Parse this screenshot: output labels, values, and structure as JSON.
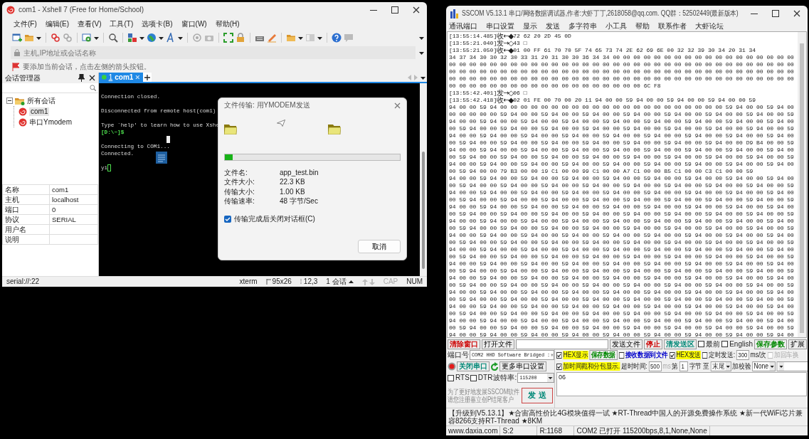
{
  "xshell": {
    "title": "com1 - Xshell 7 (Free for Home/School)",
    "menu": [
      "文件(F)",
      "编辑(E)",
      "查看(V)",
      "工具(T)",
      "选项卡(B)",
      "窗口(W)",
      "帮助(H)"
    ],
    "address": {
      "placeholder": "主机,IP地址或会话名称"
    },
    "hint": "要添加当前会话，点击左侧的箭头按钮。",
    "session_manager": {
      "title": "会话管理器",
      "tree": [
        {
          "label": "所有会话",
          "expanded": true,
          "children": [
            {
              "label": "com1",
              "selected": true
            },
            {
              "label": "串口Ymodem",
              "selected": false
            }
          ]
        }
      ],
      "properties": [
        {
          "name": "名称",
          "value": "com1"
        },
        {
          "name": "主机",
          "value": "localhost"
        },
        {
          "name": "端口",
          "value": "0"
        },
        {
          "name": "协议",
          "value": "SERIAL"
        },
        {
          "name": "用户名"
        },
        {
          "name": "说明"
        }
      ]
    },
    "tabs": [
      {
        "number": "1",
        "label": "com1",
        "selected": true,
        "connected": true
      }
    ],
    "terminal": {
      "lines": [
        {
          "kind": "blank"
        },
        {
          "kind": "text",
          "text": "Connection closed."
        },
        {
          "kind": "blank"
        },
        {
          "kind": "text",
          "text": "Disconnected from remote host(com1)"
        },
        {
          "kind": "blank"
        },
        {
          "kind": "text",
          "text": "Type `help' to learn how to use Xshe"
        },
        {
          "kind": "prompt",
          "text": "[D:\\~]$"
        },
        {
          "kind": "cursor"
        },
        {
          "kind": "text",
          "text": "Connecting to COM1..."
        },
        {
          "kind": "text",
          "text": "Connected."
        },
        {
          "kind": "blank"
        },
        {
          "kind": "input",
          "text": "yi"
        }
      ]
    },
    "dialog": {
      "title": "文件传输: 用YMODEM发送",
      "level": 0.045,
      "fields": [
        {
          "label": "文件名:",
          "value": "app_test.bin"
        },
        {
          "label": "文件大小:",
          "value": "22.3 KB"
        },
        {
          "label": "传输大小:",
          "value": "1.00 KB"
        },
        {
          "label": "传输速率:",
          "value": "48 字节/Sec"
        }
      ],
      "close_when_done": {
        "label": "传输完成后关闭对话框(C)",
        "checked": true
      },
      "cancel": "取消"
    },
    "status_bar": {
      "path": "serial://:22",
      "terminal_type": "xterm",
      "size": "95x26",
      "cursor": "12,3",
      "sessions": "1 会话",
      "keys": [
        {
          "label": "CAP",
          "on": false
        },
        {
          "label": "NUM",
          "on": true
        }
      ]
    }
  },
  "sscom": {
    "title": "SSCOM V5.13.1 串口/网络数据调试器,作者:大虾丁丁,2618058@qq.com. QQ群：52502449(最新版本)",
    "menu": [
      "通讯端口",
      "串口设置",
      "显示",
      "发送",
      "多字符串",
      "小工具",
      "帮助",
      "联系作者",
      "大虾论坛"
    ],
    "log": [
      {
        "time": "[13:55:14.485]",
        "dir": "收←◆",
        "bytes": "72 62 20 2D 45 0D"
      },
      {
        "time": "[13:55:21.040]",
        "dir": "发→◇",
        "bytes": "43 □"
      },
      {
        "time": "[13:55:21.050]",
        "dir": "收←◆",
        "bytes": "01 00 FF 61 70 70 5F 74 65 73 74 2E 62 69 6E 00 32 32 39 30 34 20 31 34"
      },
      {
        "bytes": "34 37 34 30 30 32 30 33 31 20 31 30 30 36 34 34 00 00 00 00 00 00 00 00 00 00 00 00 00 00 00 00 00 00"
      },
      {
        "bytes": "00 00 00 00 00 00 00 00 00 00 00 00 00 00 00 00 00 00 00 00 00 00 00 00 00 00 00 00 00 00 00 00 00 00"
      },
      {
        "bytes": "00 00 00 00 00 00 00 00 00 00 00 00 00 00 00 00 00 00 00 00 00 00 00 00 00 00 00 00 00 00 00 00 00 00"
      },
      {
        "bytes": "00 00 00 00 00 00 00 00 00 00 00 00 00 00 00 00 00 00 00 00 00 00 00 00 00 00 00 00 00 00 00 00 00 00"
      },
      {
        "bytes": "00 00 00 00 00 00 00 00 00 00 00 00 00 00 00 00 00 00 00 6C F8"
      },
      {
        "time": "[13:55:42.401]",
        "dir": "发→◇",
        "bytes": "06 □"
      },
      {
        "time": "[13:55:42.418]",
        "dir": "收←◆",
        "bytes": "02 01 FE 00 70 00 20 11 94 00 00 59 94 00 00 59 94 00 00 59 94 00 00 59"
      },
      {
        "bytes": "94 00 00 59 94 00 00 00 00 00 00 00 00 00 00 00 00 00 00 00 00 00 00 00 00 00 00 59 94 00 00 59 94 00"
      },
      {
        "bytes": "00 00 00 00 00 59 94 00 00 59 94 00 00 59 94 00 00 59 94 00 00 59 94 00 00 59 94 00 00 59 94 00 00 59"
      },
      {
        "bytes": "94 00 00 59 94 00 00 59 94 00 00 59 94 00 00 59 94 00 00 59 94 00 00 59 94 00 00 59 94 00 00 59 94 00"
      },
      {
        "bytes": "00 59 94 00 00 59 94 00 00 59 94 00 00 59 94 00 00 59 94 00 00 59 94 00 00 59 94 00 00 59 94 00 00 59"
      },
      {
        "bytes": "94 00 00 59 94 00 00 59 94 00 00 59 94 00 00 59 94 00 00 59 94 00 00 59 94 00 00 59 94 00 00 59 94 00"
      },
      {
        "bytes": "00 59 94 00 00 59 94 00 00 59 94 00 00 59 94 00 00 59 94 00 00 59 94 00 00 59 94 00 00 D9 B4 00 00 59"
      },
      {
        "bytes": "94 00 00 59 94 00 00 59 94 00 00 59 94 00 00 59 94 00 00 59 94 00 00 59 94 00 00 59 94 00 00 59 94 00"
      },
      {
        "bytes": "00 59 94 00 00 59 94 00 00 59 94 00 00 59 94 00 00 59 94 00 00 59 94 00 00 59 94 00 00 59 94 00 00 59"
      },
      {
        "bytes": "94 00 00 59 94 00 00 59 94 00 00 59 94 00 00 59 94 00 00 59 94 00 00 59 94 00 00 59 94 00 00 59 94 00"
      },
      {
        "bytes": "00 59 94 00 00 79 B3 00 00 19 C1 00 00 99 C1 00 00 A7 C1 00 00 B5 C1 00 00 C3 C1 00 00 59"
      },
      {
        "bytes": "94 00 00 59 94 00 00 59 94 00 00 59 94 00 00 59 94 00 00 59 94 00 00 59 94 00 00 59 94 00 00 59 94 00"
      },
      {
        "bytes": "00 59 94 00 00 59 94 00 00 59 94 00 00 59 94 00 00 59 94 00 00 59 94 00 00 59 94 00 00 59 94 00 00 59"
      },
      {
        "bytes": "94 00 00 59 94 00 00 59 94 00 00 59 94 00 00 59 94 00 00 59 94 00 00 59 94 00 00 59 94 00 00 59 94 00"
      },
      {
        "bytes": "00 59 94 00 00 59 94 00 00 59 94 00 00 59 94 00 00 59 94 00 00 59 94 00 00 59 94 00 00 59 94 00 00 59"
      },
      {
        "bytes": "94 00 00 59 94 00 00 59 94 00 00 59 94 00 00 59 94 00 00 59 94 00 00 59 94 00 00 59 94 00 00 59 94 00"
      },
      {
        "bytes": "00 59 94 00 00 59 94 00 00 59 94 00 00 59 94 00 00 59 94 00 00 59 94 00 00 59 94 00 00 59 94 00 00 59"
      },
      {
        "bytes": "94 00 00 59 94 00 00 59 94 00 00 59 94 00 00 59 94 00 00 59 94 00 00 59 94 00 00 59 94 00 00 59 94 00"
      },
      {
        "bytes": "00 59 94 00 00 59 94 00 00 59 94 00 00 59 94 00 00 59 94 00 00 59 94 00 00 59 94 00 00 59 94 00 00 59"
      },
      {
        "bytes": "94 00 00 59 94 00 00 59 94 00 00 59 94 00 00 59 94 00 00 59 94 00 00 59 94 00 00 59 94 00 00 59 94 00"
      },
      {
        "bytes": "00 59 94 00 00 59 94 00 00 59 94 00 00 59 94 00 00 59 94 00 00 59 94 00 00 59 94 00 00 59 94 00 00 59"
      },
      {
        "bytes": "94 00 00 59 94 00 00 59 94 00 00 59 94 00 00 59 94 00 00 59 94 00 00 59 94 00 00 59 94 00 00 59 94 00"
      },
      {
        "bytes": "00 59 94 00 00 59 94 00 00 59 94 00 00 59 94 00 00 59 94 00 00 59 94 00 00 59 94 00 00 59 94 00 00 59"
      },
      {
        "bytes": "94 00 00 59 94 00 00 59 94 00 00 59 94 00 00 59 94 00 00 59 94 00 00 59 94 00 00 59 94 00 00 59 94 00"
      },
      {
        "bytes": "00 59 94 00 00 59 94 00 00 59 94 00 00 59 94 00 00 59 94 00 00 59 94 00 00 59 94 00 00 59 94 00 00 59"
      },
      {
        "bytes": "94 00 00 59 94 00 00 59 94 00 00 59 94 00 00 59 94 00 00 59 94 00 00 59 94 00 00 59 94 00 00 59 94 00"
      },
      {
        "bytes": "00 59 94 00 00 59 94 00 00 59 94 00 00 59 94 00 00 59 94 00 00 59 94 00 00 59 94 00 00 59 94 00 00 59"
      },
      {
        "bytes": "94 00 00 59 94 00 00 59 94 00 00 59 94 00 00 59 94 00 00 59 94 00 00 59 94 00 00 59 94 00 00 59 94 00"
      },
      {
        "bytes": "00 59 94 00 00 59 94 00 00 59 94 00 00 59 94 00 00 59 94 00 00 59 94 00 00 59 94 00 00 59 94 00 00 59"
      },
      {
        "bytes": "94 00 00 59 94 00 00 59 94 00 00 59 94 00 00 59 94 00 00 59 94 00 00 59 94 00 00 59 94 00 00 59 94 00"
      },
      {
        "bytes": "00 59 94 00 00 59 94 00 00 59 94 00 00 59 94 00 00 59 94 00 00 59 94 00 00 59 94 00 00 59 94 00 00 59"
      },
      {
        "bytes": "94 00 00 59 94 00 00 59 94 00 00 59 94 00 00 59 94 00 00 59 94 00 00 59 94 00 00 59 94 00 00 59 94 00"
      },
      {
        "bytes": "00 59 94 00 00 59 94 00 00 59 94 00 00 59 94 00 00 59 94 00 00 59 94 00 00 59 94 00 00 59 94 00 00 59"
      },
      {
        "bytes": "94 00 00 59 94 00 00 59 94 00 00 59 94 00 00 59 94 00 00 59 94 00 00 59 94 00 00 59 94 00 00 59 94 00"
      }
    ],
    "toolbar": [
      {
        "kind": "button",
        "label": "清除窗口",
        "color": "#cc0000"
      },
      {
        "kind": "button",
        "label": "打开文件"
      },
      {
        "kind": "field"
      },
      {
        "kind": "button",
        "label": "发送文件"
      },
      {
        "kind": "button",
        "label": "停止",
        "color": "#cc0000"
      },
      {
        "kind": "button",
        "label": "清发送区",
        "color": "#008877"
      },
      {
        "kind": "check",
        "label": "最前",
        "checked": false
      },
      {
        "kind": "check",
        "label": "English",
        "checked": false
      },
      {
        "kind": "button",
        "label": "保存参数",
        "color": "#008800"
      },
      {
        "kind": "button",
        "label": "扩展"
      }
    ],
    "port_panel": [
      [
        {
          "kind": "label",
          "label": "端口号"
        },
        {
          "kind": "select",
          "value": "COM2 HHD Software Bridged :"
        }
      ],
      [
        {
          "kind": "led",
          "on": true
        },
        {
          "kind": "button",
          "label": "关闭串口",
          "color": "#008877"
        },
        {
          "kind": "refresh"
        },
        {
          "kind": "button",
          "label": "更多串口设置"
        }
      ],
      [
        {
          "kind": "check",
          "label": "RTS",
          "checked": false
        },
        {
          "kind": "check",
          "label": "DTR",
          "checked": false
        },
        {
          "kind": "label",
          "label": "波特率:"
        },
        {
          "kind": "select",
          "value": "115200"
        }
      ]
    ],
    "notice": [
      "为了更好地发展SSCOM软件",
      "请您注册嘉立创P结尾客户"
    ],
    "send_button": "发 送",
    "options": [
      [
        {
          "kind": "check",
          "label": "HEX显示",
          "checked": true,
          "highlight": true
        },
        {
          "kind": "button",
          "label": "保存数据",
          "color": "#008800"
        },
        {
          "kind": "check",
          "label": "接收数据到文件",
          "checked": false,
          "color": "#0000cc"
        },
        {
          "kind": "check",
          "label": "HEX发送",
          "checked": true,
          "highlight": true
        },
        {
          "kind": "check",
          "label": "定时发送:",
          "checked": false
        },
        {
          "kind": "field",
          "value": "300"
        },
        {
          "kind": "label",
          "label": "ms/次"
        },
        {
          "kind": "check",
          "label": "加回车换",
          "checked": false,
          "disabled": true
        }
      ],
      [
        {
          "kind": "check",
          "label": "加时间戳和分包显示.",
          "checked": true,
          "highlight": true
        },
        {
          "kind": "label",
          "label": "超时时间:"
        },
        {
          "kind": "field",
          "value": "500"
        },
        {
          "kind": "label",
          "label": "ms",
          "disabled": true
        },
        {
          "kind": "label",
          "label": "第"
        },
        {
          "kind": "field",
          "value": "1"
        },
        {
          "kind": "label",
          "label": "字节 至"
        },
        {
          "kind": "select",
          "value": "末尾"
        },
        {
          "kind": "label",
          "label": "加校验"
        },
        {
          "kind": "select",
          "value": "None"
        },
        {
          "kind": "select"
        }
      ]
    ],
    "send_text": "06",
    "marquee": "【升级到V5.13.1】★合宙高性价比4G模块值得一试 ★RT-Thread中国人的开源免费操作系统 ★新一代WiFi芯片兼容8266支持RT-Thread ★8KM",
    "status_bar": [
      "www.daxia.com",
      "S:2",
      "R:1168",
      "COM2 已打开  115200bps,8,1,None,None"
    ]
  }
}
